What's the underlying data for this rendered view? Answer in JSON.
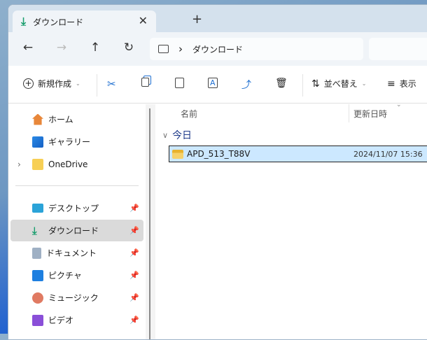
{
  "tab": {
    "title": "ダウンロード",
    "close": "✕",
    "new_tab": "+"
  },
  "nav": {
    "back": "←",
    "forward": "→",
    "up": "↑",
    "refresh": "↻"
  },
  "address": {
    "separator": "›",
    "path": "ダウンロード"
  },
  "toolbar": {
    "new_label": "新規作成",
    "sort_label": "並べ替え",
    "view_label": "表示"
  },
  "sidebar": {
    "items": [
      {
        "label": "ホーム",
        "icon": "home-icon"
      },
      {
        "label": "ギャラリー",
        "icon": "gallery-icon"
      },
      {
        "label": "OneDrive",
        "icon": "folder-icon"
      },
      {
        "label": "デスクトップ",
        "icon": "desktop-icon",
        "pinned": true
      },
      {
        "label": "ダウンロード",
        "icon": "download-icon",
        "pinned": true,
        "selected": true
      },
      {
        "label": "ドキュメント",
        "icon": "document-icon",
        "pinned": true
      },
      {
        "label": "ピクチャ",
        "icon": "pictures-icon",
        "pinned": true
      },
      {
        "label": "ミュージック",
        "icon": "music-icon",
        "pinned": true
      },
      {
        "label": "ビデオ",
        "icon": "video-icon",
        "pinned": true
      }
    ]
  },
  "columns": {
    "name": "名前",
    "modified": "更新日時"
  },
  "group": {
    "label": "今日"
  },
  "files": [
    {
      "name": "APD_513_T88V",
      "modified": "2024/11/07 15:36",
      "icon": "zip-folder-icon"
    }
  ]
}
